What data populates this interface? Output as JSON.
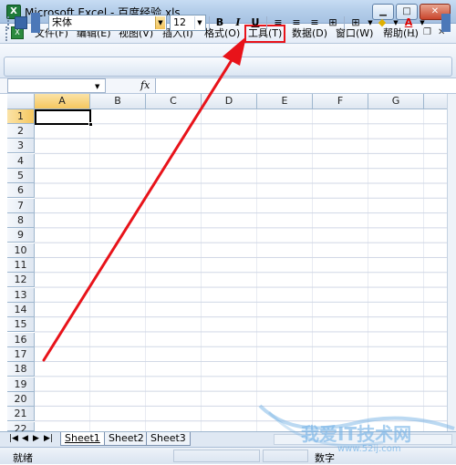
{
  "window": {
    "title": "Microsoft Excel - 百度经验.xls",
    "min_glyph": "▁",
    "max_glyph": "□",
    "close_glyph": "✕"
  },
  "menu": {
    "items": [
      {
        "label": "文件(F)"
      },
      {
        "label": "编辑(E)"
      },
      {
        "label": "视图(V)"
      },
      {
        "label": "插入(I)"
      },
      {
        "label": "格式(O)"
      },
      {
        "label": "工具(T)"
      },
      {
        "label": "数据(D)"
      },
      {
        "label": "窗口(W)"
      },
      {
        "label": "帮助(H)"
      }
    ],
    "mdi_min": "_",
    "mdi_restore": "❐",
    "mdi_close": "✕"
  },
  "toolbar": {
    "font_name": "宋体",
    "font_size": "12",
    "bold": "B",
    "italic": "I",
    "underline": "U",
    "font_color_glyph": "A"
  },
  "formula_bar": {
    "name_box": "",
    "fx_label": "fx"
  },
  "grid": {
    "columns": [
      "A",
      "B",
      "C",
      "D",
      "E",
      "F",
      "G"
    ],
    "rows": [
      "1",
      "2",
      "3",
      "4",
      "5",
      "6",
      "7",
      "8",
      "9",
      "10",
      "11",
      "12",
      "13",
      "14",
      "15",
      "16",
      "17",
      "18",
      "19",
      "20",
      "21",
      "22"
    ],
    "active_cell": "A1"
  },
  "sheets": {
    "tabs": [
      "Sheet1",
      "Sheet2",
      "Sheet3"
    ],
    "active": "Sheet1",
    "nav": [
      "|◀",
      "◀",
      "▶",
      "▶|"
    ]
  },
  "status": {
    "ready": "就绪",
    "num": "数字"
  },
  "watermark": {
    "text": "我爱IT技术网",
    "url": "www.52ij.com"
  },
  "colors": {
    "highlight_border": "#e8131a",
    "arrow": "#e8131a"
  }
}
